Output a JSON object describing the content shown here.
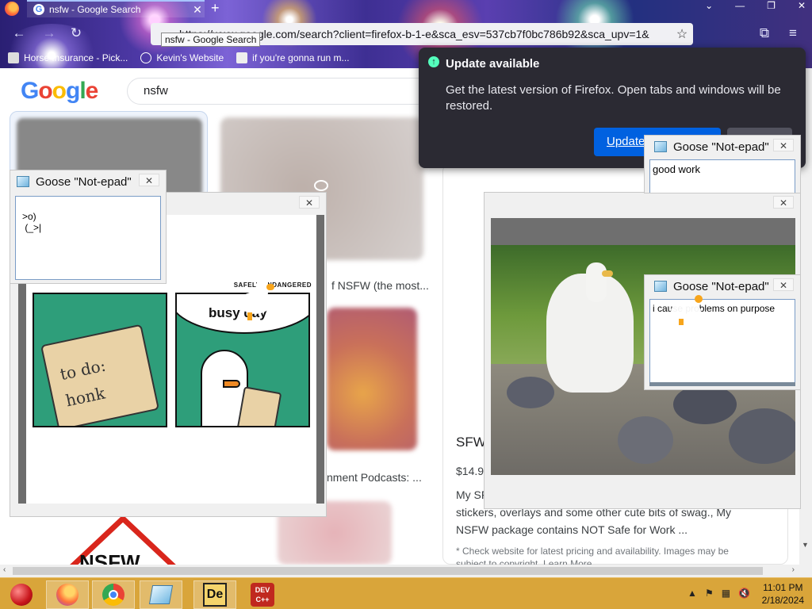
{
  "browser": {
    "tab_title": "nsfw - Google Search",
    "tab_close": "✕",
    "new_tab": "+",
    "url": "https://www.google.com/search?client=firefox-b-1-e&sca_esv=537cb7f0bc786b92&sca_upv=1&",
    "tooltip": "nsfw - Google Search",
    "bookmarks": [
      {
        "label": "Horse Insurance - Pick..."
      },
      {
        "label": "Kevin's Website"
      },
      {
        "label": "if you're gonna run m..."
      }
    ]
  },
  "google": {
    "query": "nsfw",
    "results": {
      "img_caption_1": "f NSFW (the most...",
      "img_caption_2": "nment Podcasts: ...",
      "shop_title": "SFW",
      "shop_price": "$14.9",
      "shop_snippet_1": "My SF",
      "shop_snippet_2": "stickers, overlays and some other cute bits of swag., My",
      "shop_snippet_3": "NSFW package contains NOT Safe for Work ...",
      "shop_note": "* Check website for latest pricing and availability. Images may be",
      "shop_note_2": "subject to copyright. Learn More",
      "bottom_sign": "NSFW"
    }
  },
  "update_popup": {
    "title": "Update available",
    "body": "Get the latest version of Firefox. Open tabs and windows will be restored.",
    "update_button": "Update"
  },
  "goose_windows": [
    {
      "title": "Goose \"Not-epad\"",
      "text": ">o)\n (_>|"
    },
    {
      "title": "Goose \"Not-epad\"",
      "text": "good work"
    },
    {
      "title": "Goose \"Not-epad\"",
      "text": "i cause problems on purpose"
    }
  ],
  "meme": {
    "panel_left_text": "to do:\nhonk",
    "panel_right_text": "busy day",
    "watermark": "SAFELY ENDANGERED"
  },
  "taskbar": {
    "time": "11:01 PM",
    "date": "2/18/2024",
    "apps": [
      "christmas-ornament",
      "firefox",
      "chrome",
      "notepad",
      "de",
      "dev-cpp"
    ],
    "dev_label": "DEV C++",
    "de_label": "De"
  },
  "colors": {
    "taskbar": "#d9a53a",
    "update_bg": "#2b2a33",
    "update_button": "#0061e0",
    "meme_green": "#2e9e7a"
  }
}
